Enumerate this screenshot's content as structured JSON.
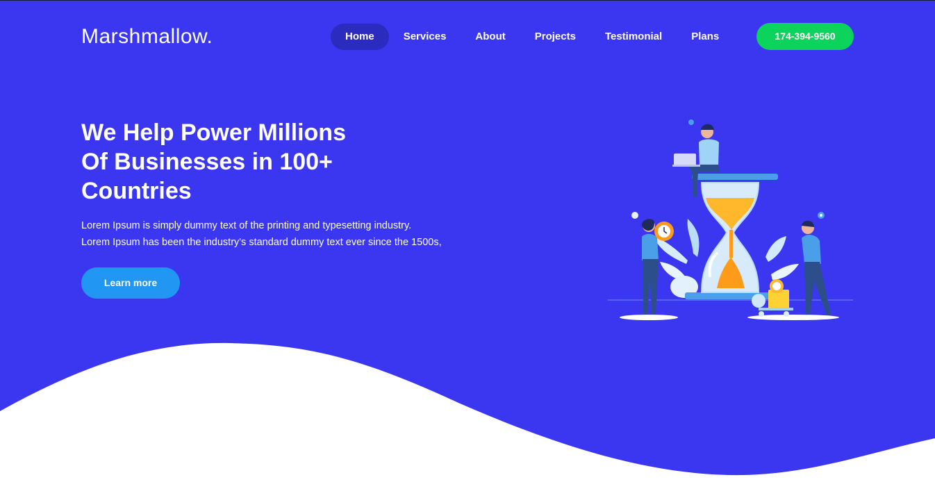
{
  "brand": {
    "name": "Marshmallow."
  },
  "nav": {
    "items": [
      {
        "label": "Home",
        "active": true
      },
      {
        "label": "Services"
      },
      {
        "label": "About"
      },
      {
        "label": "Projects"
      },
      {
        "label": "Testimonial"
      },
      {
        "label": "Plans"
      }
    ],
    "phone": "174-394-9560"
  },
  "hero": {
    "title_line1": "We Help Power Millions",
    "title_line2": "Of Businesses in 100+",
    "title_line3": "Countries",
    "text_line1": "Lorem Ipsum is simply dummy text of the printing and typesetting industry.",
    "text_line2": "Lorem Ipsum has been the industry's standard dummy text ever since the 1500s,",
    "cta": "Learn more"
  },
  "colors": {
    "background": "#3b37f1",
    "nav_active": "#2b2bbf",
    "phone_button": "#0bd35c",
    "cta_button": "#2196f3",
    "wave": "#ffffff"
  },
  "icons": [
    "hourglass-illustration-icon"
  ]
}
